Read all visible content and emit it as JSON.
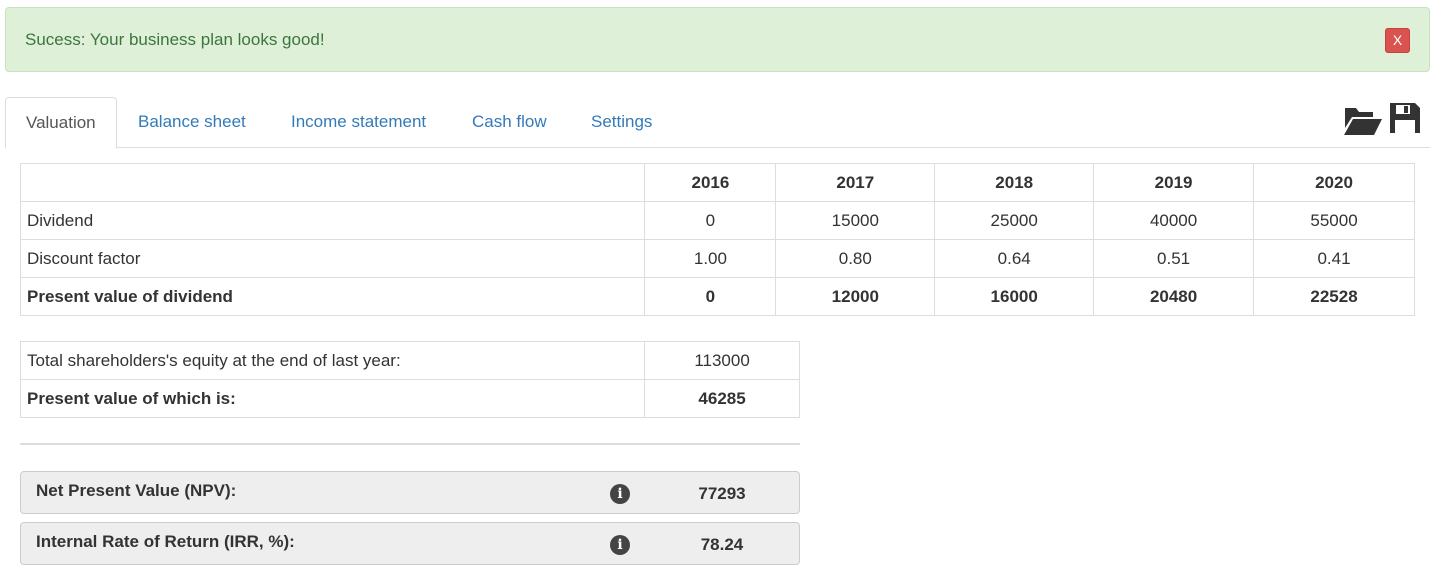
{
  "alert": {
    "message": "Sucess: Your business plan looks good!",
    "close_label": "X"
  },
  "tabs": [
    {
      "label": "Valuation",
      "active": true
    },
    {
      "label": "Balance sheet",
      "active": false
    },
    {
      "label": "Income statement",
      "active": false
    },
    {
      "label": "Cash flow",
      "active": false
    },
    {
      "label": "Settings",
      "active": false
    }
  ],
  "toolbar": {
    "icons": [
      "folder-open-icon",
      "save-icon"
    ]
  },
  "valuation_table": {
    "years": [
      "2016",
      "2017",
      "2018",
      "2019",
      "2020"
    ],
    "rows": [
      {
        "label": "Dividend",
        "values": [
          "0",
          "15000",
          "25000",
          "40000",
          "55000"
        ]
      },
      {
        "label": "Discount factor",
        "values": [
          "1.00",
          "0.80",
          "0.64",
          "0.51",
          "0.41"
        ]
      },
      {
        "label": "Present value of dividend",
        "values": [
          "0",
          "12000",
          "16000",
          "20480",
          "22528"
        ]
      }
    ]
  },
  "equity": {
    "total_label": "Total shareholders's equity at the end of last year:",
    "total_value": "113000",
    "pv_label": "Present value of which is:",
    "pv_value": "46285"
  },
  "kpis": {
    "npv": {
      "label": "Net Present Value (NPV):",
      "value": "77293",
      "info_icon": "i"
    },
    "irr": {
      "label": "Internal Rate of Return (IRR, %):",
      "value": "78.24",
      "info_icon": "i"
    }
  },
  "colors": {
    "alert_bg": "#dff0d8",
    "alert_text": "#3c763d",
    "close_button": "#d9534f",
    "link": "#337ab7"
  }
}
